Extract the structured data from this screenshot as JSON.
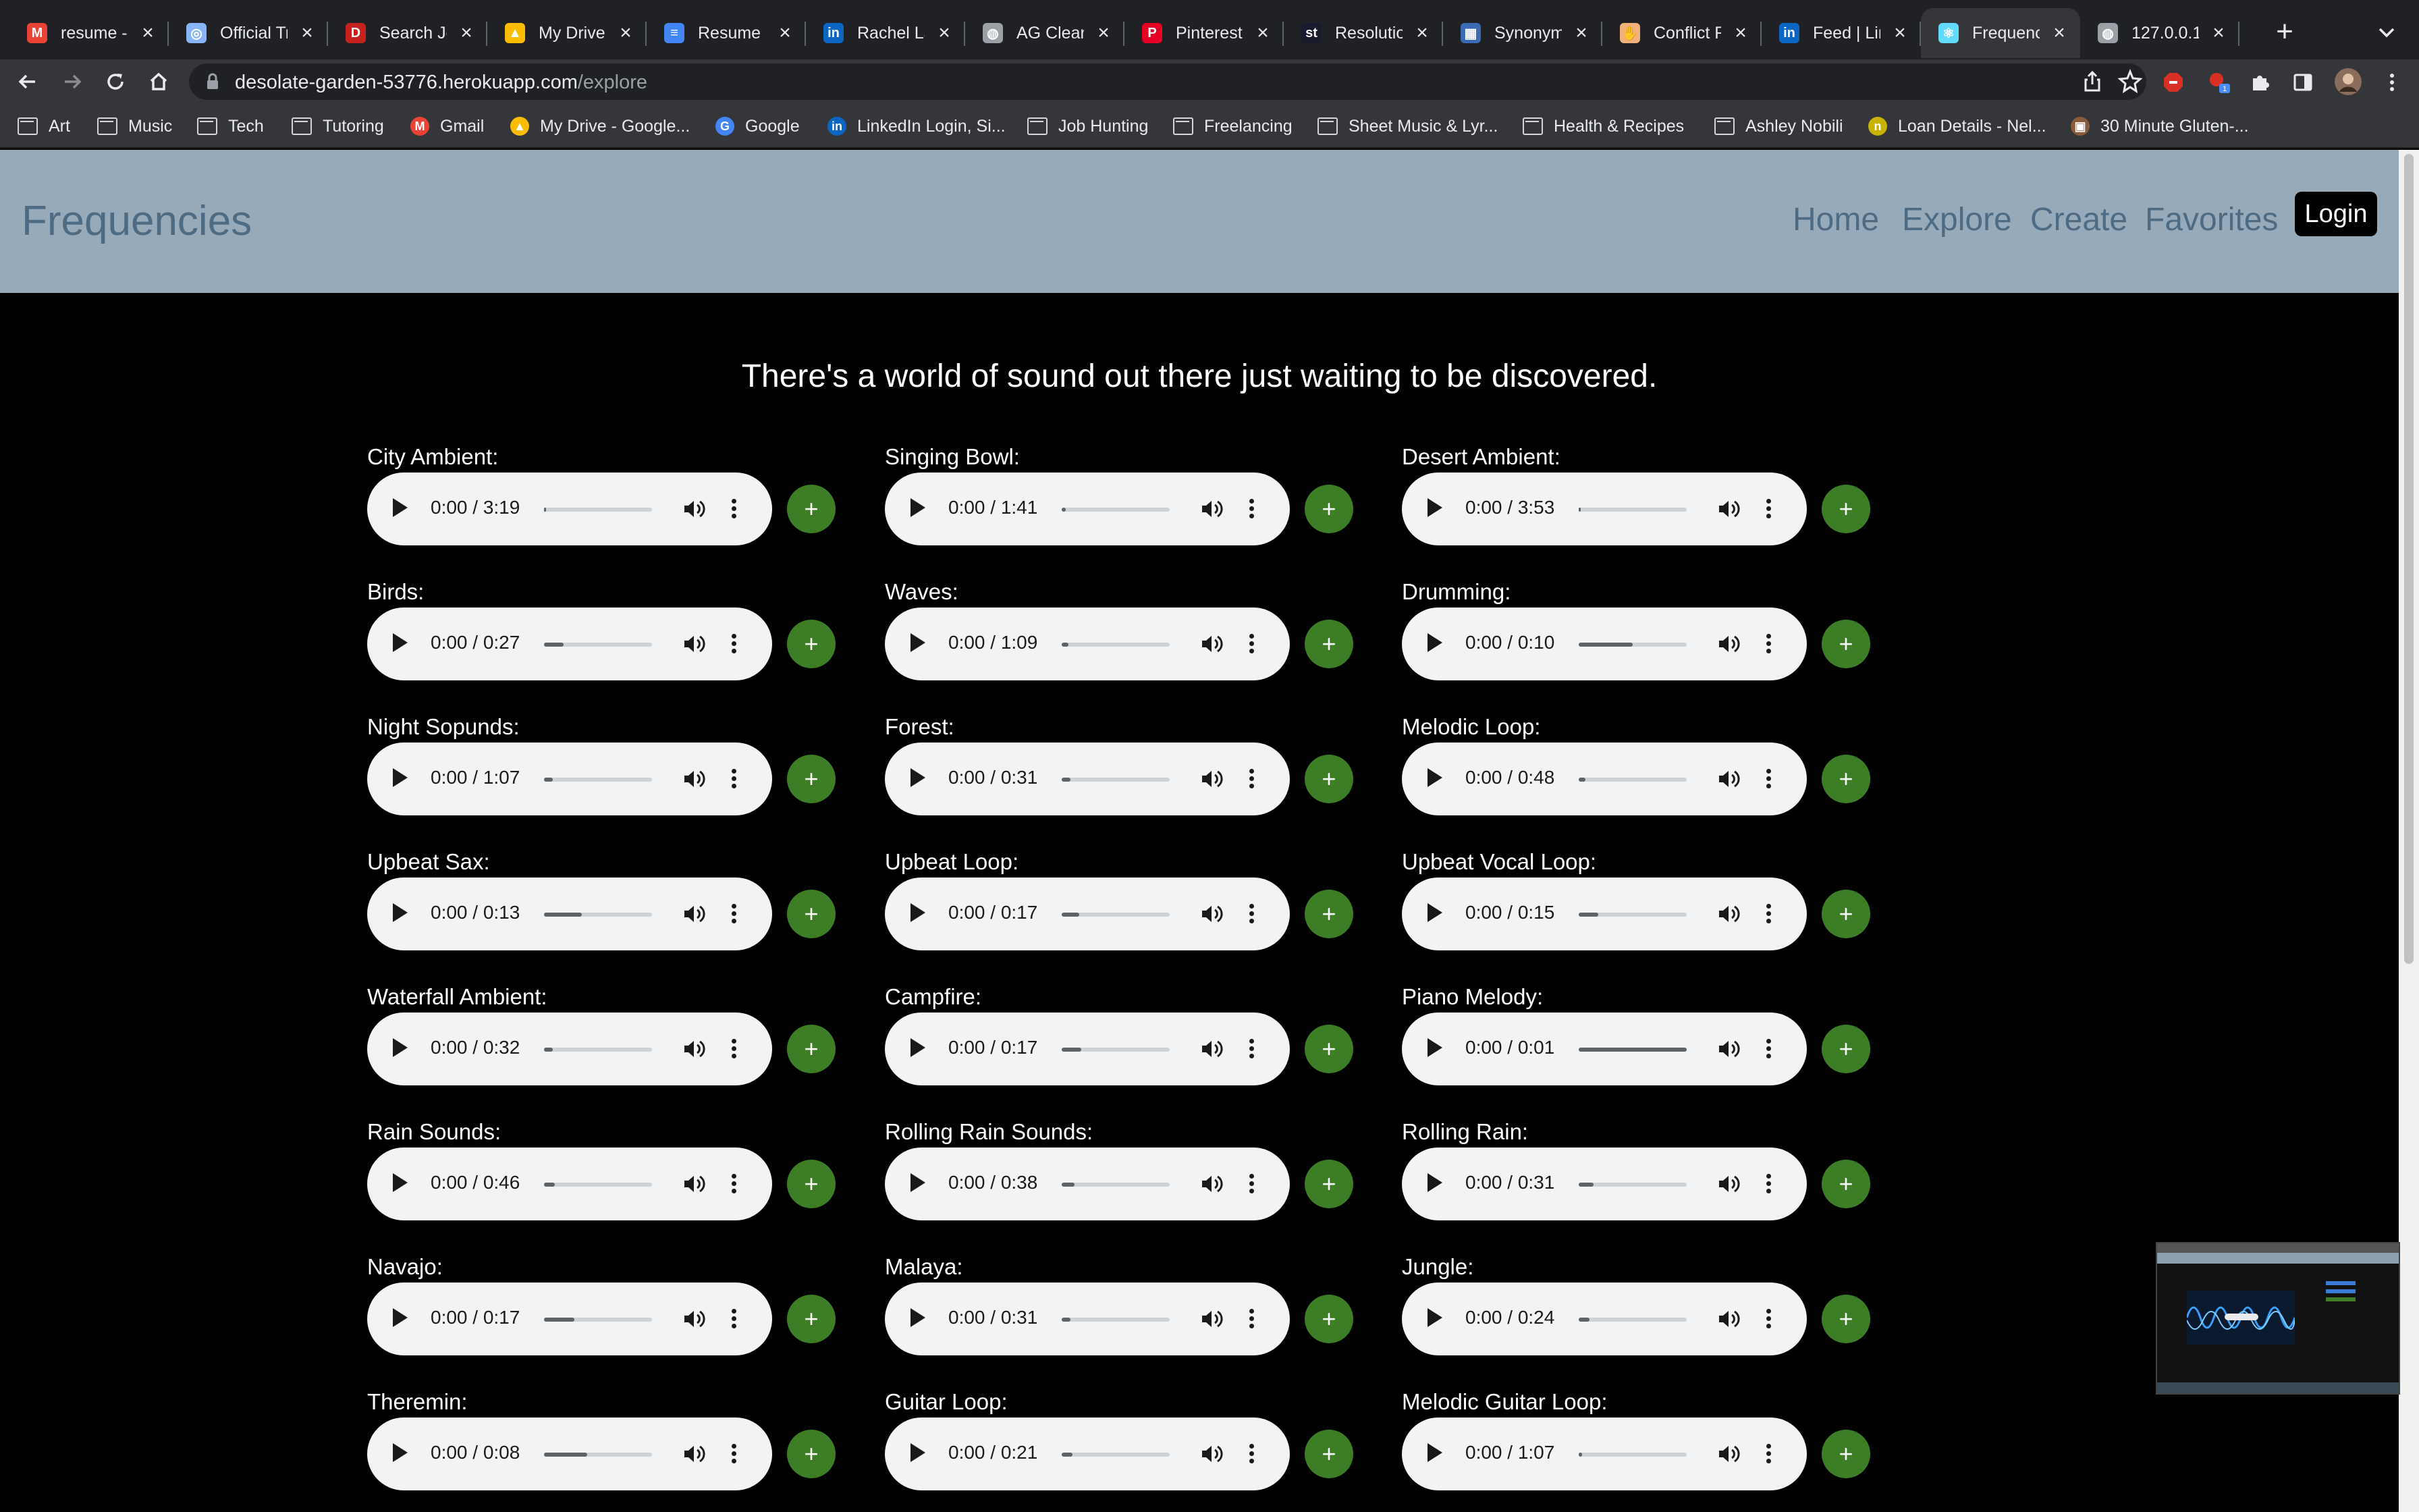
{
  "browser": {
    "tabs": [
      {
        "title": "resume -",
        "icon": "gmail-icon",
        "color": "#ea4335",
        "glyph": "M",
        "active": false
      },
      {
        "title": "Official Tr",
        "icon": "globe-icon",
        "color": "#8ab4f8",
        "glyph": "◎",
        "active": false
      },
      {
        "title": "Search Jo",
        "icon": "dice-icon",
        "color": "#c5221f",
        "glyph": "D",
        "active": false
      },
      {
        "title": "My Drive",
        "icon": "drive-icon",
        "color": "#fbbc04",
        "glyph": "▲",
        "active": false
      },
      {
        "title": "Resume -",
        "icon": "docs-icon",
        "color": "#4285f4",
        "glyph": "≡",
        "active": false
      },
      {
        "title": "Rachel La",
        "icon": "linkedin-icon",
        "color": "#0a66c2",
        "glyph": "in",
        "active": false
      },
      {
        "title": "AG Clean",
        "icon": "globe-icon",
        "color": "#9aa0a6",
        "glyph": "◍",
        "active": false
      },
      {
        "title": "Pinterest",
        "icon": "pinterest-icon",
        "color": "#e60023",
        "glyph": "P",
        "active": false
      },
      {
        "title": "Resolution",
        "icon": "st-icon",
        "color": "#1a1a2e",
        "glyph": "st",
        "active": false
      },
      {
        "title": "Synonym",
        "icon": "thesaurus-icon",
        "color": "#3c6bb5",
        "glyph": "▦",
        "active": false
      },
      {
        "title": "Conflict R",
        "icon": "hand-icon",
        "color": "#f0b27a",
        "glyph": "✋",
        "active": false
      },
      {
        "title": "Feed | Lin",
        "icon": "linkedin-icon",
        "color": "#0a66c2",
        "glyph": "in",
        "active": false
      },
      {
        "title": "Frequenc",
        "icon": "react-icon",
        "color": "#61dafb",
        "glyph": "⚛",
        "active": true
      },
      {
        "title": "127.0.0.1",
        "icon": "globe-icon",
        "color": "#9aa0a6",
        "glyph": "◍",
        "active": false
      }
    ],
    "url_host": "desolate-garden-53776.herokuapp.com",
    "url_path": "/explore",
    "bookmarks": [
      {
        "label": "Art",
        "type": "folder"
      },
      {
        "label": "Music",
        "type": "folder"
      },
      {
        "label": "Tech",
        "type": "folder"
      },
      {
        "label": "Tutoring",
        "type": "folder"
      },
      {
        "label": "Gmail",
        "type": "gmail"
      },
      {
        "label": "My Drive - Google...",
        "type": "drive"
      },
      {
        "label": "Google",
        "type": "google"
      },
      {
        "label": "LinkedIn Login, Si...",
        "type": "linkedin"
      },
      {
        "label": "Job Hunting",
        "type": "folder"
      },
      {
        "label": "Freelancing",
        "type": "folder"
      },
      {
        "label": "Sheet Music & Lyr...",
        "type": "folder"
      },
      {
        "label": "Health & Recipes",
        "type": "folder"
      },
      {
        "label": "Ashley Nobili",
        "type": "folder"
      },
      {
        "label": "Loan Details - Nel...",
        "type": "loan"
      },
      {
        "label": "30 Minute Gluten-...",
        "type": "recipe"
      }
    ]
  },
  "app": {
    "brand": "Frequencies",
    "nav": [
      "Home",
      "Explore",
      "Create",
      "Favorites"
    ],
    "login_label": "Login",
    "hero": "There's a world of sound out there just waiting to be discovered.",
    "add_label": "+",
    "sounds": [
      {
        "name": "City Ambient:",
        "time": "0:00 / 3:19",
        "buffered": 0.02
      },
      {
        "name": "Singing Bowl:",
        "time": "0:00 / 1:41",
        "buffered": 0.04
      },
      {
        "name": "Desert Ambient:",
        "time": "0:00 / 3:53",
        "buffered": 0.02
      },
      {
        "name": "Birds:",
        "time": "0:00 / 0:27",
        "buffered": 0.18
      },
      {
        "name": "Waves:",
        "time": "0:00 / 1:09",
        "buffered": 0.06
      },
      {
        "name": "Drumming:",
        "time": "0:00 / 0:10",
        "buffered": 0.5
      },
      {
        "name": "Night Sopunds:",
        "time": "0:00 / 1:07",
        "buffered": 0.08
      },
      {
        "name": "Forest:",
        "time": "0:00 / 0:31",
        "buffered": 0.08
      },
      {
        "name": "Melodic Loop:",
        "time": "0:00 / 0:48",
        "buffered": 0.06
      },
      {
        "name": "Upbeat Sax:",
        "time": "0:00 / 0:13",
        "buffered": 0.35
      },
      {
        "name": "Upbeat Loop:",
        "time": "0:00 / 0:17",
        "buffered": 0.16
      },
      {
        "name": "Upbeat Vocal Loop:",
        "time": "0:00 / 0:15",
        "buffered": 0.18
      },
      {
        "name": "Waterfall Ambient:",
        "time": "0:00 / 0:32",
        "buffered": 0.08
      },
      {
        "name": "Campfire:",
        "time": "0:00 / 0:17",
        "buffered": 0.18
      },
      {
        "name": "Piano Melody:",
        "time": "0:00 / 0:01",
        "buffered": 1.0
      },
      {
        "name": "Rain Sounds:",
        "time": "0:00 / 0:46",
        "buffered": 0.1
      },
      {
        "name": "Rolling Rain Sounds:",
        "time": "0:00 / 0:38",
        "buffered": 0.12
      },
      {
        "name": "Rolling Rain:",
        "time": "0:00 / 0:31",
        "buffered": 0.14
      },
      {
        "name": "Navajo:",
        "time": "0:00 / 0:17",
        "buffered": 0.28
      },
      {
        "name": "Malaya:",
        "time": "0:00 / 0:31",
        "buffered": 0.08
      },
      {
        "name": "Jungle:",
        "time": "0:00 / 0:24",
        "buffered": 0.1
      },
      {
        "name": "Theremin:",
        "time": "0:00 / 0:08",
        "buffered": 0.4
      },
      {
        "name": "Guitar Loop:",
        "time": "0:00 / 0:21",
        "buffered": 0.1
      },
      {
        "name": "Melodic Guitar Loop:",
        "time": "0:00 / 1:07",
        "buffered": 0.03
      }
    ]
  },
  "colors": {
    "navbar_bg": "#97aab9",
    "brand_text": "#4e6b84",
    "add_button": "#3d7d25",
    "player_bg": "#f1f3f4",
    "page_bg": "#000000"
  }
}
